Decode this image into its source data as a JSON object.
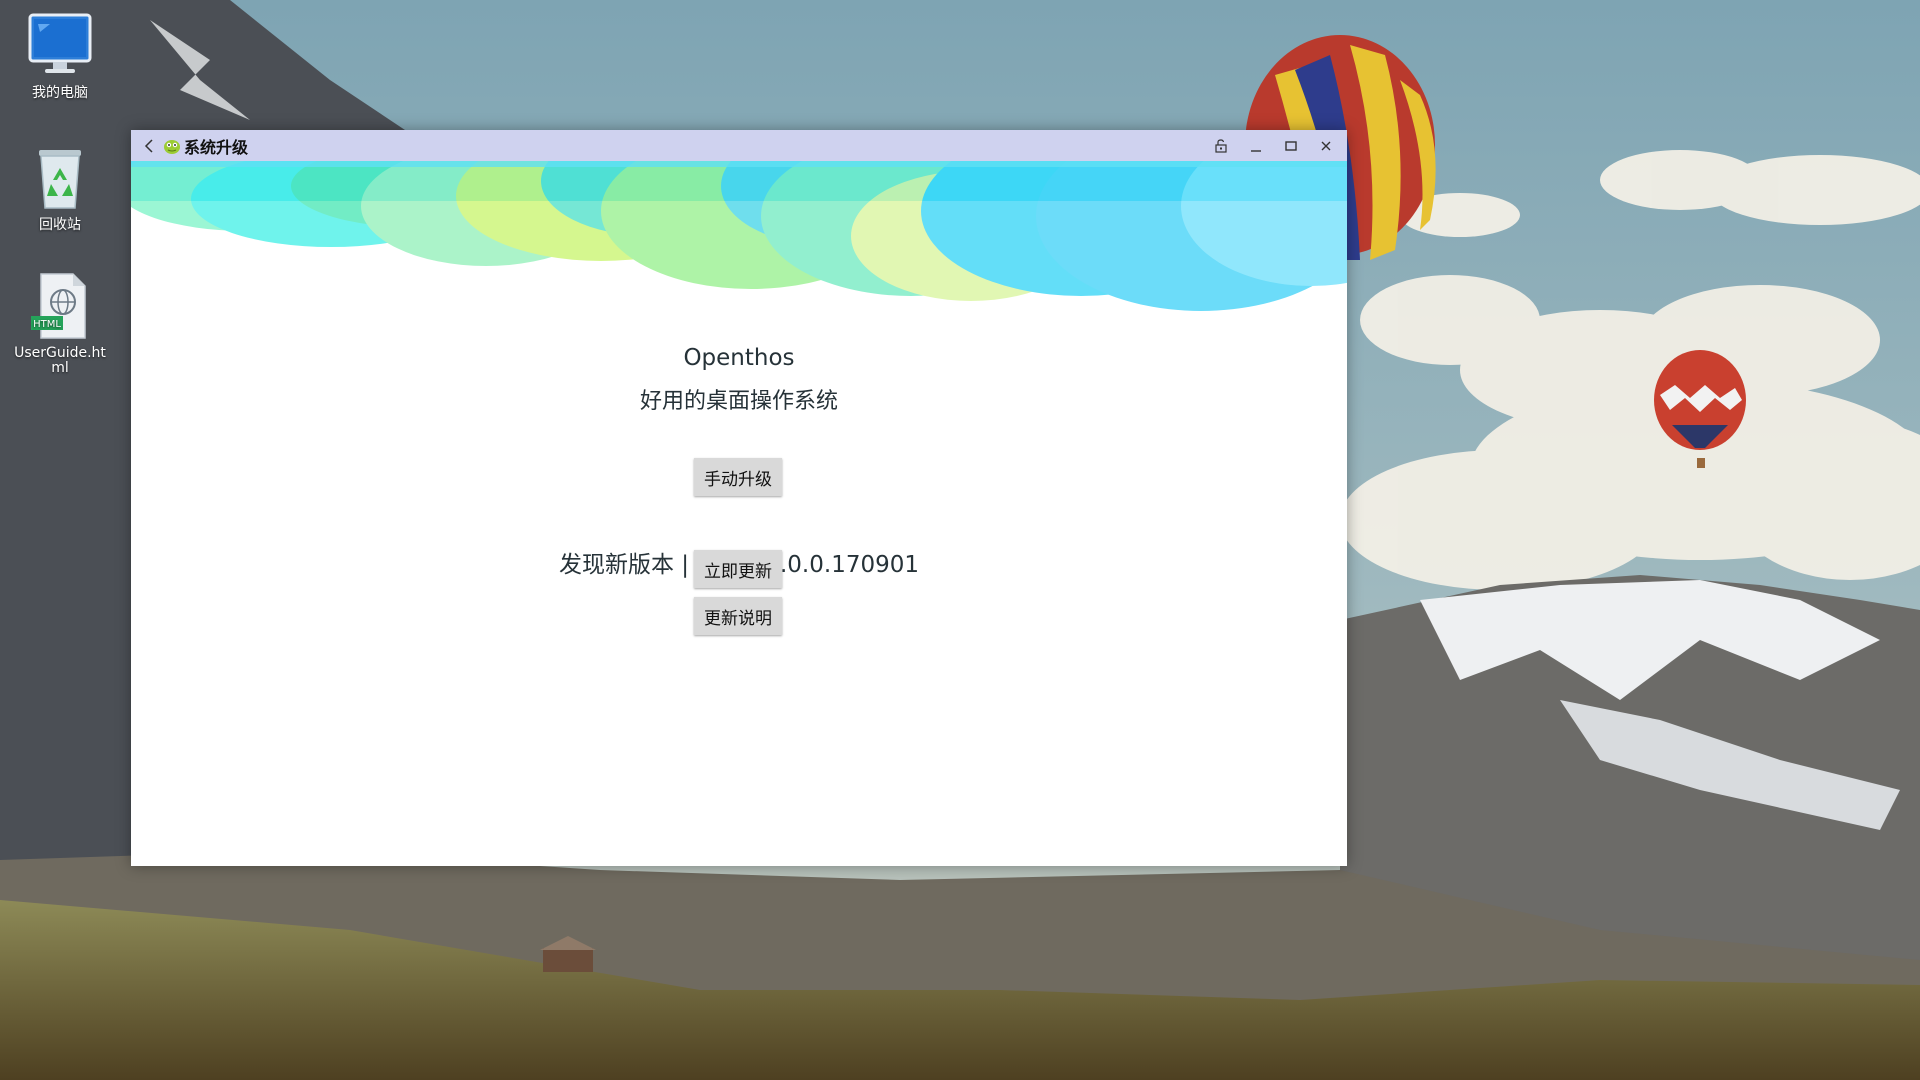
{
  "desktop": {
    "icons": [
      {
        "label": "我的电脑"
      },
      {
        "label": "回收站"
      },
      {
        "label": "UserGuide.html"
      }
    ],
    "html_badge": "HTML"
  },
  "window": {
    "title": "系统升级",
    "controls": [
      "window-unlock-icon",
      "minimize-icon",
      "maximize-icon",
      "close-icon"
    ]
  },
  "app": {
    "name": "Openthos",
    "slogan": "好用的桌面操作系统",
    "manual_upgrade_label": "手动升级",
    "version_notice": "发现新版本 | 稳定版1.0.0.170901",
    "update_now_label": "立即更新",
    "release_notes_label": "更新说明"
  },
  "colors": {
    "titlebar": "#cfd2ef",
    "button_bg": "#d9d9d9",
    "banner_cyan": "#3dd7f7",
    "banner_green": "#5ff0b0",
    "banner_lime": "#c8f56a"
  }
}
